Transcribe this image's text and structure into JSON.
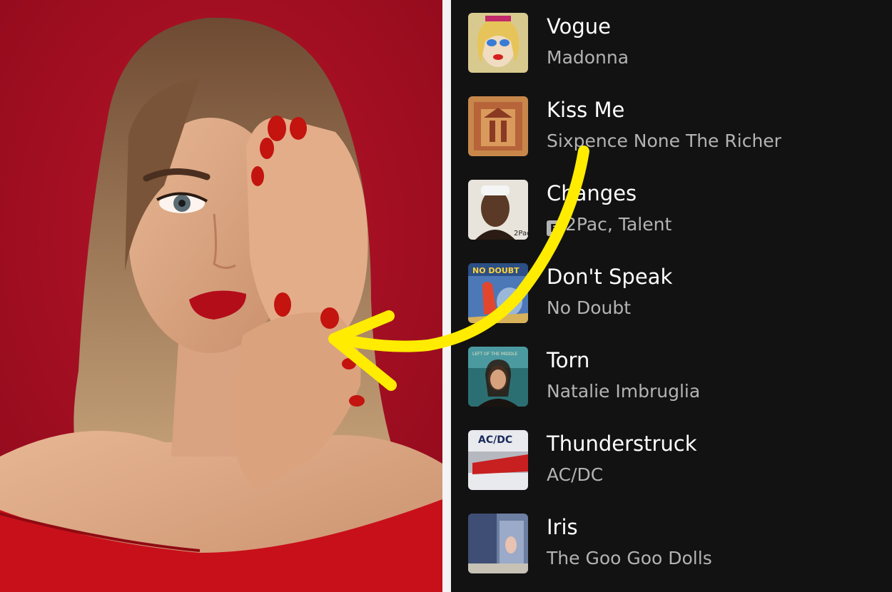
{
  "tracks": [
    {
      "title": "Vogue",
      "artist": "Madonna",
      "explicit": false,
      "art_icon": "album-art-celebration"
    },
    {
      "title": "Kiss Me",
      "artist": "Sixpence None The Richer",
      "explicit": false,
      "art_icon": "album-art-kiss-me"
    },
    {
      "title": "Changes",
      "artist": "2Pac, Talent",
      "explicit": true,
      "explicit_label": "E",
      "art_icon": "album-art-greatest-hits"
    },
    {
      "title": "Don't Speak",
      "artist": "No Doubt",
      "explicit": false,
      "art_icon": "album-art-tragic-kingdom"
    },
    {
      "title": "Torn",
      "artist": "Natalie Imbruglia",
      "explicit": false,
      "art_icon": "album-art-left-of-the-middle"
    },
    {
      "title": "Thunderstruck",
      "artist": "AC/DC",
      "explicit": false,
      "art_icon": "album-art-the-razors-edge"
    },
    {
      "title": "Iris",
      "artist": "The Goo Goo Dolls",
      "explicit": false,
      "art_icon": "album-art-dizzy-up-the-girl"
    }
  ],
  "album_art_text": {
    "greatest_hits": "2Pac",
    "tragic_kingdom": "NO DOUBT",
    "torn": "LEFT OF THE MIDDLE",
    "thunderstruck": "AC/DC"
  },
  "colors": {
    "photo_background": "#a70f22",
    "playlist_background": "#121212",
    "title_text": "#ffffff",
    "artist_text": "#b3b3b3",
    "arrow": "#ffec00",
    "nail_polish": "#c3140f"
  },
  "overlay": {
    "arrow_icon": "yellow-curved-arrow-icon"
  }
}
